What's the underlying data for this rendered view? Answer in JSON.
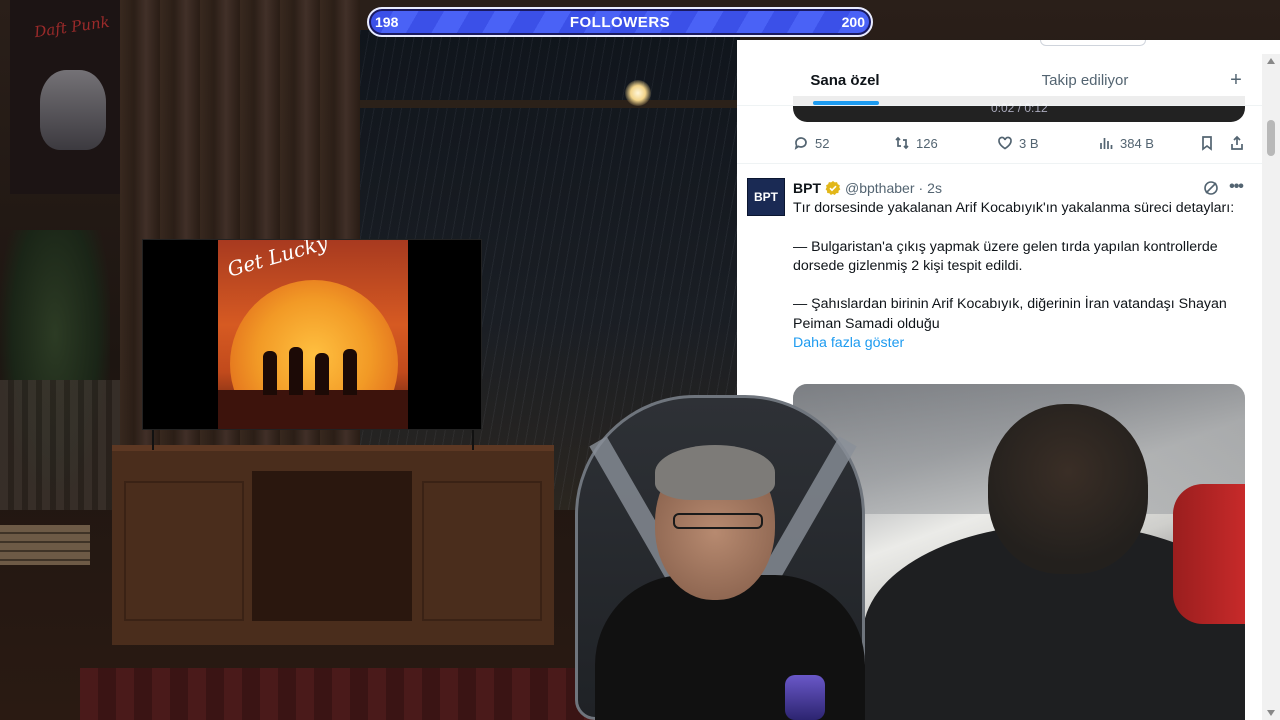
{
  "followers": {
    "current": "198",
    "label": "FOLLOWERS",
    "goal": "200"
  },
  "tv": {
    "album_title": "Get Lucky"
  },
  "poster": {
    "text": "Daft Punk"
  },
  "twitter": {
    "tabs": [
      {
        "label": "Sana özel",
        "active": true
      },
      {
        "label": "Takip ediliyor",
        "active": false
      }
    ],
    "add_tab": "+",
    "prev_video_time": "0:02 / 0:12",
    "prev_actions": {
      "replies": "52",
      "reposts": "126",
      "likes": "3 B",
      "views": "384 B"
    },
    "tweet": {
      "avatar_text": "BPT",
      "author_name": "BPT",
      "handle": "@bpthaber",
      "separator": "·",
      "time": "2s",
      "lines": [
        "Tır dorsesinde yakalanan Arif Kocabıyık'ın yakalanma süreci detayları:",
        "— Bulgaristan'a çıkış yapmak üzere gelen tırda yapılan kontrollerde dorsede gizlenmiş 2 kişi tespit edildi.",
        "— Şahıslardan birinin Arif Kocabıyık, diğerinin İran vatandaşı Shayan Peiman Samadi olduğu"
      ],
      "show_more": "Daha fazla göster"
    }
  },
  "colors": {
    "accent": "#1d9bf0",
    "followers_bar": "#3b50e8",
    "text_primary": "#0f1419",
    "text_secondary": "#536471"
  }
}
